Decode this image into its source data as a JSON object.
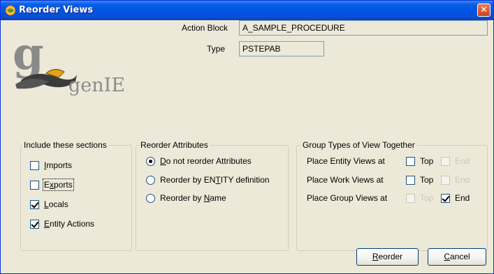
{
  "window": {
    "title": "Reorder Views",
    "close_glyph": "✕"
  },
  "logo": {
    "text": "genIE",
    "accent_color": "#e8a21a"
  },
  "fields": {
    "action_block_label": "Action Block",
    "action_block_value": "A_SAMPLE_PROCEDURE",
    "type_label": "Type",
    "type_value": "PSTEPAB"
  },
  "include_sections": {
    "title": "Include these sections",
    "items": [
      {
        "pre": "",
        "mn": "I",
        "post": "mports",
        "checked": false
      },
      {
        "pre": "E",
        "mn": "x",
        "post": "ports",
        "checked": false
      },
      {
        "pre": "",
        "mn": "L",
        "post": "ocals",
        "checked": true
      },
      {
        "pre": "",
        "mn": "E",
        "post": "ntity Actions",
        "checked": true
      }
    ]
  },
  "reorder_attributes": {
    "title": "Reorder Attributes",
    "options": [
      {
        "pre": "",
        "mn": "D",
        "post": "o not reorder Attributes",
        "selected": true
      },
      {
        "pre": "Reorder by EN",
        "mn": "T",
        "post": "ITY definition",
        "selected": false
      },
      {
        "pre": "Reorder by ",
        "mn": "N",
        "post": "ame",
        "selected": false
      }
    ]
  },
  "group_types": {
    "title": "Group Types of View Together",
    "rows": [
      {
        "label": "Place Entity Views at",
        "top_label": "Top",
        "top_checked": false,
        "top_enabled": true,
        "end_label": "End",
        "end_checked": false,
        "end_enabled": false
      },
      {
        "label": "Place Work Views at",
        "top_label": "Top",
        "top_checked": false,
        "top_enabled": true,
        "end_label": "End",
        "end_checked": false,
        "end_enabled": false
      },
      {
        "label": "Place Group Views at",
        "top_label": "Top",
        "top_checked": false,
        "top_enabled": false,
        "end_label": "End",
        "end_checked": true,
        "end_enabled": true
      }
    ]
  },
  "buttons": {
    "reorder": {
      "mn": "R",
      "post": "eorder"
    },
    "cancel": {
      "mn": "C",
      "post": "ancel"
    }
  }
}
